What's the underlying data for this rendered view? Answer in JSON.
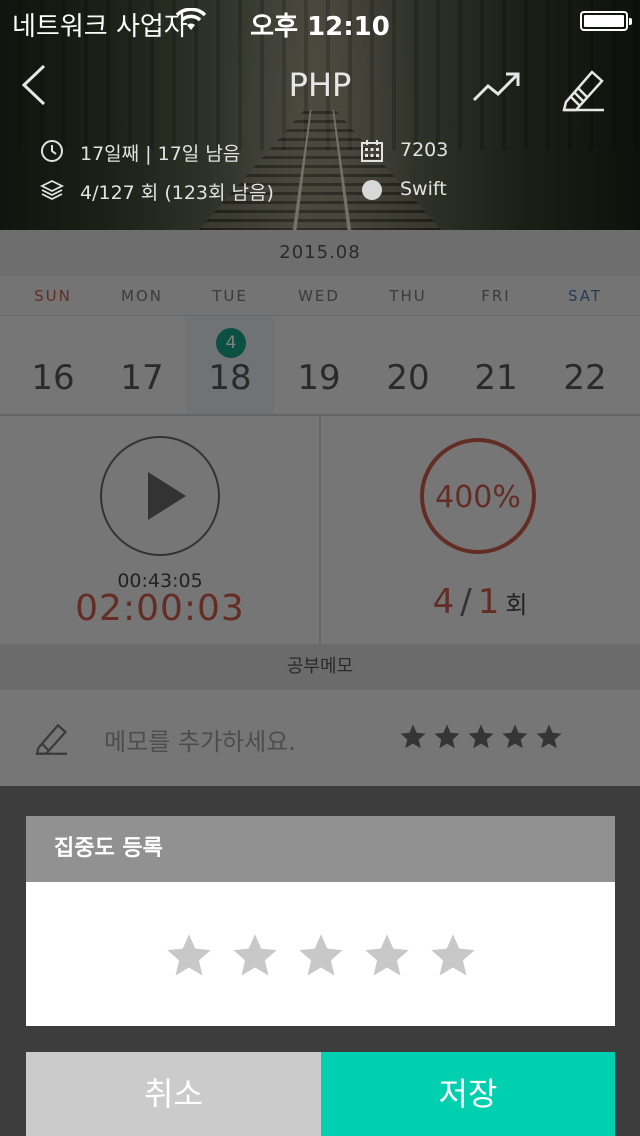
{
  "status_bar": {
    "carrier": "네트워크 사업자",
    "time": "오후 12:10"
  },
  "header": {
    "title": "PHP",
    "day_progress": "17일째 | 17일 남음",
    "sessions": "4/127 회 (123회 남음)",
    "code": "7203",
    "tag": "Swift"
  },
  "calendar": {
    "month": "2015.08",
    "weekdays": [
      "SUN",
      "MON",
      "TUE",
      "WED",
      "THU",
      "FRI",
      "SAT"
    ],
    "dates": [
      "16",
      "17",
      "18",
      "19",
      "20",
      "21",
      "22"
    ],
    "selected_badge": "4",
    "colors": {
      "sun": "#c45a4a",
      "sat": "#4a7ab8"
    }
  },
  "timer": {
    "elapsed": "00:43:05",
    "total": "02:00:03"
  },
  "progress": {
    "percent": "400%",
    "done": "4",
    "separator": "/",
    "goal": "1",
    "unit": "회",
    "ring_fill": 1.0
  },
  "memo": {
    "section_title": "공부메모",
    "placeholder": "메모를 추가하세요.",
    "rating_stars": 5
  },
  "dialog": {
    "title": "집중도 등록",
    "star_count": 5,
    "cancel_label": "취소",
    "save_label": "저장"
  },
  "colors": {
    "accent": "#00cfb0",
    "badge": "#19a086",
    "highlight": "#c65a4a"
  }
}
